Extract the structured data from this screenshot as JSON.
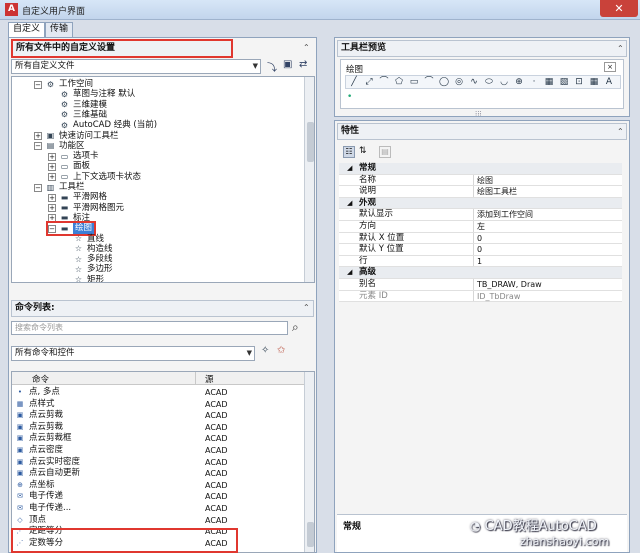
{
  "window": {
    "title": "自定义用户界面",
    "close_glyph": "✕"
  },
  "tabs": [
    {
      "label": "自定义"
    },
    {
      "label": "传输"
    }
  ],
  "left": {
    "section_title": "所有文件中的自定义设置",
    "file_combo": "所有自定义文件",
    "tree": [
      {
        "label": "工作空间",
        "depth": 1,
        "exp": "⊟",
        "icon": "⚙"
      },
      {
        "label": "草图与注释 默认",
        "depth": 2,
        "exp": "",
        "icon": "⚙"
      },
      {
        "label": "三维建模",
        "depth": 2,
        "exp": "",
        "icon": "⚙"
      },
      {
        "label": "三维基础",
        "depth": 2,
        "exp": "",
        "icon": "⚙"
      },
      {
        "label": "AutoCAD 经典 (当前)",
        "depth": 2,
        "exp": "",
        "icon": "⚙"
      },
      {
        "label": "快速访问工具栏",
        "depth": 1,
        "exp": "⊞",
        "icon": "▣"
      },
      {
        "label": "功能区",
        "depth": 1,
        "exp": "⊟",
        "icon": "▤"
      },
      {
        "label": "选项卡",
        "depth": 2,
        "exp": "⊞",
        "icon": "▭"
      },
      {
        "label": "面板",
        "depth": 2,
        "exp": "⊞",
        "icon": "▭"
      },
      {
        "label": "上下文选项卡状态",
        "depth": 2,
        "exp": "⊞",
        "icon": "▭"
      },
      {
        "label": "工具栏",
        "depth": 1,
        "exp": "⊟",
        "icon": "▥"
      },
      {
        "label": "平滑网格",
        "depth": 2,
        "exp": "⊞",
        "icon": "▬"
      },
      {
        "label": "平滑网格图元",
        "depth": 2,
        "exp": "⊞",
        "icon": "▬"
      },
      {
        "label": "标注",
        "depth": 2,
        "exp": "⊞",
        "icon": "▬"
      },
      {
        "label": "绘图",
        "depth": 2,
        "exp": "⊟",
        "icon": "▬",
        "selected": true
      },
      {
        "label": "直线",
        "depth": 3,
        "exp": "",
        "icon": "☆"
      },
      {
        "label": "构造线",
        "depth": 3,
        "exp": "",
        "icon": "☆"
      },
      {
        "label": "多段线",
        "depth": 3,
        "exp": "",
        "icon": "☆"
      },
      {
        "label": "多边形",
        "depth": 3,
        "exp": "",
        "icon": "☆"
      },
      {
        "label": "矩形",
        "depth": 3,
        "exp": "",
        "icon": "☆"
      }
    ],
    "command_list_title": "命令列表:",
    "search_placeholder": "搜索命令列表",
    "filter_combo": "所有命令和控件",
    "col_command": "命令",
    "col_source": "源",
    "commands": [
      {
        "name": "点, 多点",
        "source": "ACAD",
        "icon": "•"
      },
      {
        "name": "点样式",
        "source": "ACAD",
        "icon": "▦"
      },
      {
        "name": "点云剪裁",
        "source": "ACAD",
        "icon": "▣"
      },
      {
        "name": "点云剪裁",
        "source": "ACAD",
        "icon": "▣"
      },
      {
        "name": "点云剪裁框",
        "source": "ACAD",
        "icon": "▣"
      },
      {
        "name": "点云密度",
        "source": "ACAD",
        "icon": "▣"
      },
      {
        "name": "点云实时密度",
        "source": "ACAD",
        "icon": "▣"
      },
      {
        "name": "点云自动更新",
        "source": "ACAD",
        "icon": "▣"
      },
      {
        "name": "点坐标",
        "source": "ACAD",
        "icon": "⊕"
      },
      {
        "name": "电子传递",
        "source": "ACAD",
        "icon": "✉"
      },
      {
        "name": "电子传递...",
        "source": "ACAD",
        "icon": "✉"
      },
      {
        "name": "顶点",
        "source": "ACAD",
        "icon": "◇"
      },
      {
        "name": "定距等分",
        "source": "ACAD",
        "icon": "⋰"
      },
      {
        "name": "定数等分",
        "source": "ACAD",
        "icon": "⋰"
      }
    ]
  },
  "toolbar_preview": {
    "title": "工具栏预览",
    "toolbar_name": "绘图",
    "icons": [
      "╱",
      "⤢",
      "⌒",
      "⬠",
      "▭",
      "⌒",
      "◯",
      "◎",
      "∿",
      "⬭",
      "◡",
      "⊕",
      "·",
      "▦",
      "▧",
      "⊡",
      "▦",
      "A"
    ]
  },
  "properties": {
    "title": "特性",
    "groups": [
      {
        "name": "常规",
        "rows": [
          {
            "k": "名称",
            "v": "绘图"
          },
          {
            "k": "说明",
            "v": "绘图工具栏"
          }
        ]
      },
      {
        "name": "外观",
        "rows": [
          {
            "k": "默认显示",
            "v": "添加到工作空间"
          },
          {
            "k": "方向",
            "v": "左"
          },
          {
            "k": "默认 X 位置",
            "v": "0"
          },
          {
            "k": "默认 Y 位置",
            "v": "0"
          },
          {
            "k": "行",
            "v": "1"
          }
        ]
      },
      {
        "name": "高级",
        "rows": [
          {
            "k": "别名",
            "v": "TB_DRAW, Draw"
          },
          {
            "k": "元素 ID",
            "v": "ID_TbDraw",
            "disabled": true
          }
        ]
      }
    ],
    "footer_label": "常规"
  },
  "watermark": {
    "line1": "CAD教程AutoCAD",
    "line2": "zhanshaoyi.com"
  }
}
